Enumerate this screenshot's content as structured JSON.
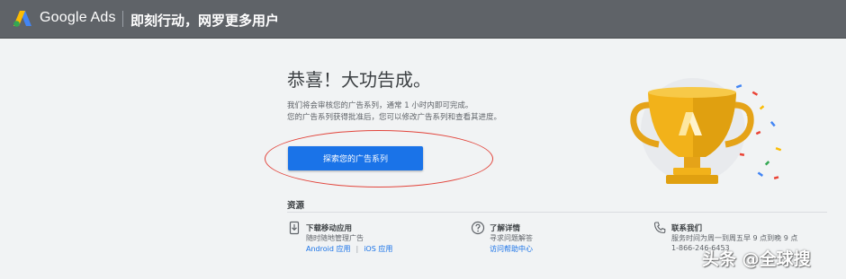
{
  "header": {
    "brand": "Google Ads",
    "tagline": "即刻行动，网罗更多用户"
  },
  "main": {
    "headline": "恭喜！大功告成。",
    "description_lines": [
      "我们将会审核您的广告系列，通常 1 小时内即可完成。",
      "您的广告系列获得批准后，您可以修改广告系列和查看其进度。"
    ],
    "cta_label": "探索您的广告系列"
  },
  "resources": {
    "label": "资源",
    "mobile": {
      "title": "下载移动应用",
      "subtitle": "随时随地管理广告",
      "links": [
        "Android 应用",
        "iOS 应用"
      ],
      "separator": "|"
    },
    "learn": {
      "title": "了解详情",
      "subtitle": "寻求问题解答",
      "link": "访问帮助中心"
    },
    "contact": {
      "title": "联系我们",
      "subtitle": "服务时间为周一到周五早 9 点到晚 9 点",
      "phone": "1-866-246-6453"
    }
  },
  "watermark": "头条 @全球搜",
  "colors": {
    "topbar": "#5f6368",
    "accent": "#1a73e8",
    "annotation": "#e2453c",
    "trophy": "#f2b21a"
  },
  "icons": {
    "logo": "google-ads-logo",
    "mobile": "phone-download-icon",
    "help": "help-icon",
    "contact": "phone-icon"
  }
}
